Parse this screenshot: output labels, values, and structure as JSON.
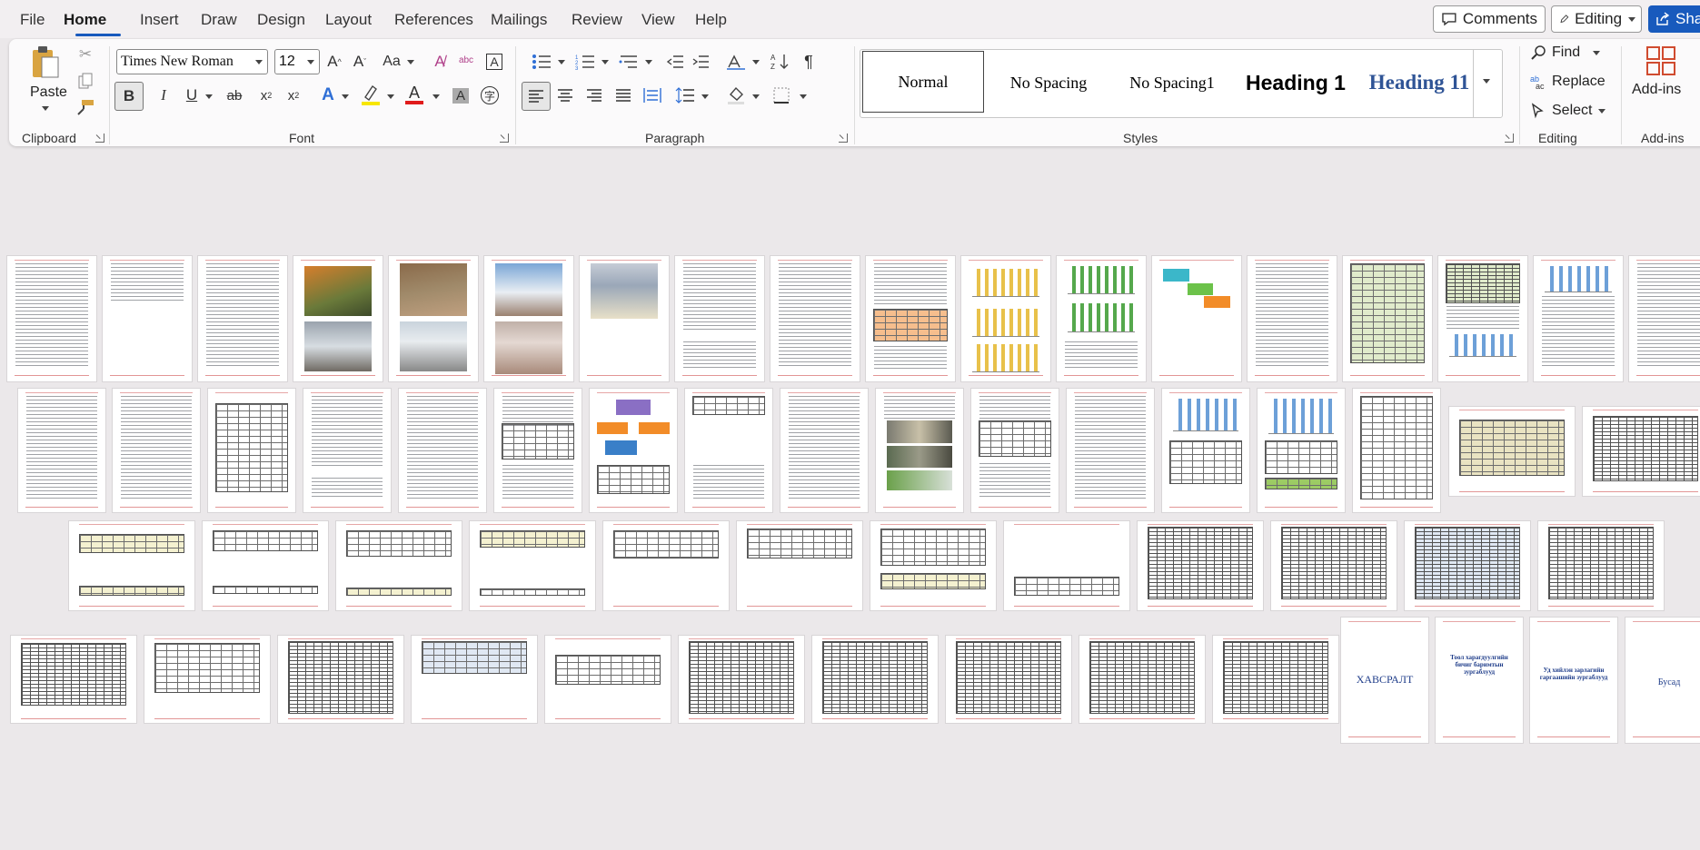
{
  "menu": {
    "items": [
      "File",
      "Home",
      "Insert",
      "Draw",
      "Design",
      "Layout",
      "References",
      "Mailings",
      "Review",
      "View",
      "Help"
    ],
    "active": "Home",
    "comments_label": "Comments",
    "editing_mode_label": "Editing",
    "share_label": "Sha"
  },
  "ribbon": {
    "clipboard": {
      "paste_label": "Paste",
      "group_label": "Clipboard"
    },
    "font": {
      "font_name": "Times New Roman",
      "font_size": "12",
      "group_label": "Font",
      "change_case_label": "Aa"
    },
    "paragraph": {
      "group_label": "Paragraph"
    },
    "styles": {
      "group_label": "Styles",
      "items": [
        "Normal",
        "No Spacing",
        "No Spacing1",
        "Heading 1",
        "Heading 11"
      ],
      "selected": "Normal"
    },
    "editing": {
      "find_label": "Find",
      "replace_label": "Replace",
      "select_label": "Select",
      "group_label": "Editing"
    },
    "addins": {
      "button_label": "Add-ins",
      "group_label": "Add-ins"
    }
  },
  "thumbnails": {
    "title_pages": [
      "ХАВСРАЛТ",
      "Тоол харагдуулгийн бичиг баримтын зургаблууд",
      "Уд хийлэн зарлагийн гаргаашийн зургаблууд",
      "Бусад"
    ]
  },
  "colors": {
    "accent": "#185abd",
    "ribbon_bg": "#fbfafb",
    "canvas_bg": "#ebe8ea",
    "heading_style_blue": "#2f5496"
  }
}
